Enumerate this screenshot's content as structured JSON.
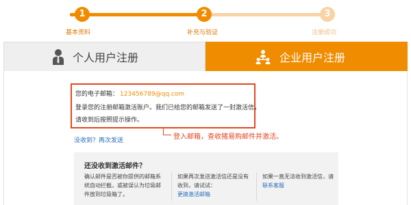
{
  "steps": [
    {
      "number": "1",
      "label": "基本资料",
      "state": "done"
    },
    {
      "number": "2",
      "label": "补充与验证",
      "state": "current"
    },
    {
      "number": "3",
      "label": "注册成功",
      "state": "pending"
    }
  ],
  "tabs": {
    "personal": {
      "label": "个人用户注册",
      "icon": "person-icon"
    },
    "enterprise": {
      "label": "企业用户注册",
      "icon": "organization-icon"
    }
  },
  "info": {
    "email_label": "您的电子邮箱：",
    "email_value": "123456789@qq.com",
    "line2": "登录您的注册邮箱激活账户。我们已给您的邮箱发送了一封激活信，",
    "line3": "请收到后按照提示操作。"
  },
  "annotation": "登入邮箱，查收猪易购邮件并激活。",
  "resend": "没收到？再次发送",
  "help": {
    "title": "还没收到激活邮件？",
    "col1": "确认邮件是否被你提供的邮箱系统自动拦截，或被误认为垃圾邮件放到垃圾箱了。",
    "col2_text": "如果再次发送激活信还是没有收到，请试试：",
    "col2_link": "更换激活邮箱",
    "col3_text": "如果一直无法收到激活信，请",
    "col3_link": "联系客服"
  },
  "colors": {
    "accent": "#f08c00",
    "accent_light": "#f8d3a6",
    "highlight_red": "#e2461f",
    "link_blue": "#2a6ebb"
  }
}
